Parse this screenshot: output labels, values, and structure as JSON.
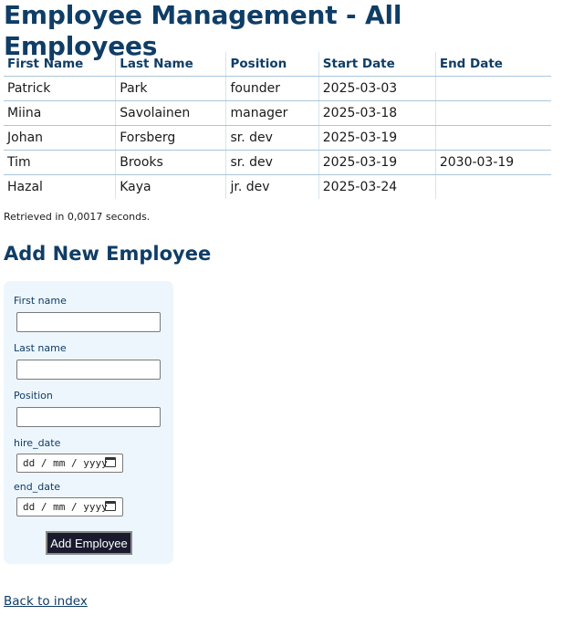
{
  "page_title": "Employee Management - All Employees",
  "table": {
    "headers": [
      "First Name",
      "Last Name",
      "Position",
      "Start Date",
      "End Date"
    ],
    "rows": [
      [
        "Patrick",
        "Park",
        "founder",
        "2025-03-03",
        ""
      ],
      [
        "Miina",
        "Savolainen",
        "manager",
        "2025-03-18",
        ""
      ],
      [
        "Johan",
        "Forsberg",
        "sr. dev",
        "2025-03-19",
        ""
      ],
      [
        "Tim",
        "Brooks",
        "sr. dev",
        "2025-03-19",
        "2030-03-19"
      ],
      [
        "Hazal",
        "Kaya",
        "jr. dev",
        "2025-03-24",
        ""
      ]
    ]
  },
  "retrieved_text": "Retrieved in 0,0017 seconds.",
  "form": {
    "heading": "Add New Employee",
    "first_name_label": "First name",
    "first_name_value": "",
    "last_name_label": "Last name",
    "last_name_value": "",
    "position_label": "Position",
    "position_value": "",
    "hire_date_label": "hire_date",
    "hire_date_placeholder": "dd / mm / yyyy",
    "end_date_label": "end_date",
    "end_date_placeholder": "dd / mm / yyyy",
    "submit_label": "Add Employee",
    "calendar_icon": "calendar-icon"
  },
  "back_link_label": "Back to index",
  "colors": {
    "heading": "#0f3d66",
    "form_background": "#eef6fd",
    "button_background": "#1a1a2e",
    "table_border": "#aac6dc"
  }
}
